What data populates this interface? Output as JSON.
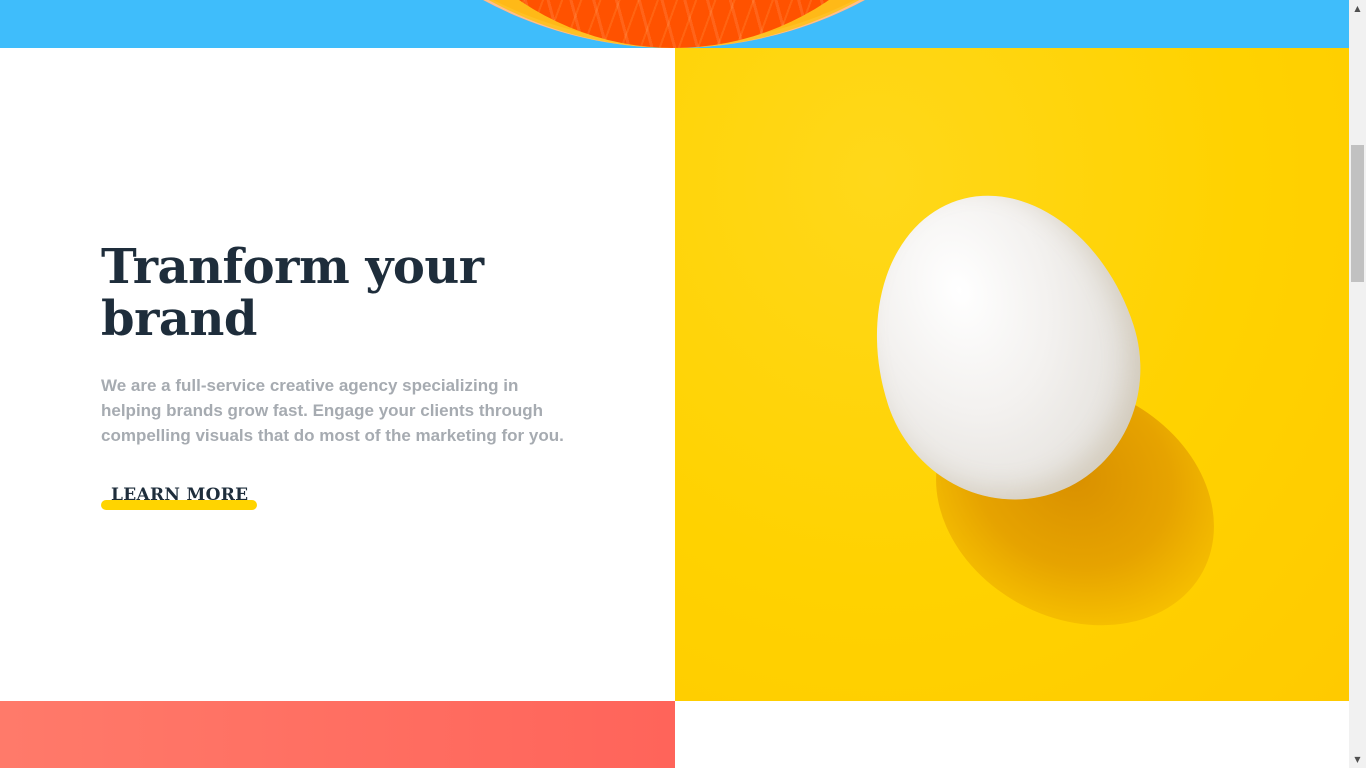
{
  "hero": {
    "title": "Tranform your brand",
    "description": "We are a full-service creative agency specializing in helping brands grow fast. Engage your clients through compelling visuals that do most of the marketing for you.",
    "cta_label": "LEARN MORE"
  },
  "colors": {
    "heading": "#1e2d3b",
    "body_text": "#a6abb1",
    "accent_yellow": "#ffd400",
    "sky_blue": "#3fbdfb",
    "coral": "#ff6f62"
  },
  "scrollbar": {
    "up_arrow": "▲",
    "down_arrow": "▼"
  }
}
